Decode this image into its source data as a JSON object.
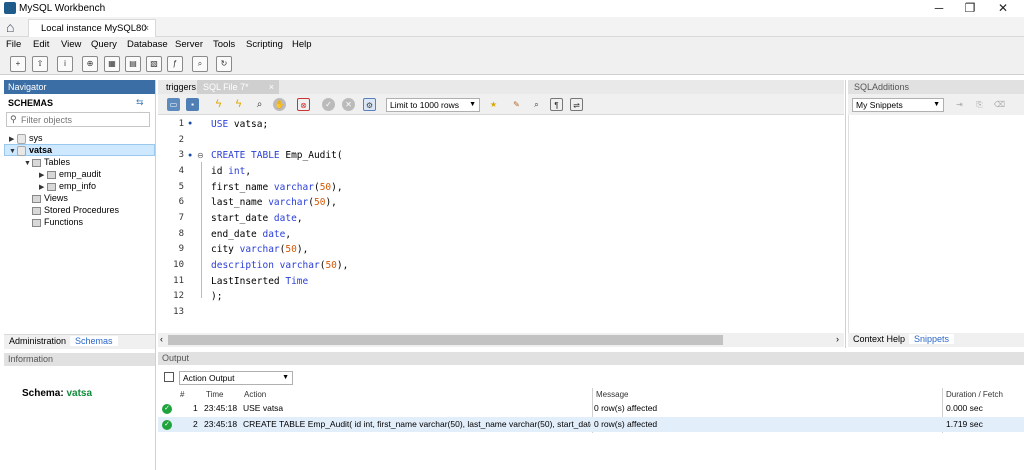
{
  "window": {
    "title": "MySQL Workbench",
    "controls": [
      "─",
      "❐",
      "✕"
    ]
  },
  "connection_tab": {
    "label": "Local instance MySQL80",
    "close": "×"
  },
  "menu": [
    "File",
    "Edit",
    "View",
    "Query",
    "Database",
    "Server",
    "Tools",
    "Scripting",
    "Help"
  ],
  "navigator": {
    "header": "Navigator",
    "schemas_label": "SCHEMAS",
    "filter_placeholder": "Filter objects",
    "tree": {
      "sys": "sys",
      "vatsa": "vatsa",
      "tables": "Tables",
      "table1": "emp_audit",
      "table2": "emp_info",
      "views": "Views",
      "procedures": "Stored Procedures",
      "functions": "Functions"
    },
    "tabs": {
      "administration": "Administration",
      "schemas": "Schemas"
    },
    "info_header": "Information",
    "schema_info": {
      "label": "Schema:",
      "value": "vatsa"
    }
  },
  "editor": {
    "tabs": {
      "triggers": "triggers",
      "sqlfile": "SQL File 7*"
    },
    "limit": "Limit to 1000 rows",
    "line_numbers": [
      "1",
      "2",
      "3",
      "4",
      "5",
      "6",
      "7",
      "8",
      "9",
      "10",
      "11",
      "12",
      "13"
    ]
  },
  "sql_additions": {
    "header": "SQLAdditions",
    "snippet_select": "My Snippets",
    "tabs": {
      "context_help": "Context Help",
      "snippets": "Snippets"
    }
  },
  "output": {
    "header": "Output",
    "action_select": "Action Output",
    "columns": {
      "num": "#",
      "time": "Time",
      "action": "Action",
      "message": "Message",
      "duration": "Duration / Fetch"
    },
    "rows": [
      {
        "num": "1",
        "time": "23:45:18",
        "action": "USE vatsa",
        "message": "0 row(s) affected",
        "duration": "0.000 sec"
      },
      {
        "num": "2",
        "time": "23:45:18",
        "action": "CREATE TABLE Emp_Audit( id int, first_name varchar(50), last_name varchar(50), start_date da...",
        "message": "0 row(s) affected",
        "duration": "1.719 sec"
      }
    ]
  },
  "colors": {
    "accent": "#3b6ea5",
    "keyword": "#2a3ed8",
    "number": "#d45a0a",
    "success": "#1fa33d",
    "schema_value": "#118a3a"
  }
}
